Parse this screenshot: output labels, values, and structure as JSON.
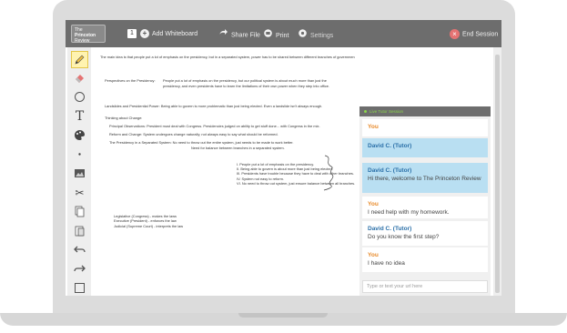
{
  "header": {
    "logo_line1": "The",
    "logo_line2": "Princeton",
    "logo_line3": "Review",
    "page_number": "1",
    "add_whiteboard": "Add Whiteboard",
    "share_file": "Share File",
    "print": "Print",
    "settings": "Settings",
    "end_session": "End Session"
  },
  "toolbar": {
    "tools": [
      "pencil-icon",
      "eraser-icon",
      "circle-shape-icon",
      "text-tool-icon",
      "color-palette-icon",
      "dot-size-icon",
      "image-icon",
      "scissors-icon",
      "copy-icon",
      "paste-icon",
      "undo-icon",
      "redo-icon",
      "rectangle-select-icon"
    ]
  },
  "canvas": {
    "line1": "The main idea is that people put a lot of emphasis on the presidency, but in a separated system, power has to be shared between different branches of governmen",
    "perspectives_label": "Perspectives on the Presidency:",
    "perspectives_text1": "People put a lot of emphasis on the presidency, but our political system is about much more than just the",
    "perspectives_text2": "presidency, and even presidents have to learn the limitations of their own power when they step into office.",
    "landslides": "Landslides and Presidential Power:  Being able to govern is more problematic than just being elected. Even a landslide isn't always enough.",
    "thinking": "Thinking about Change:",
    "principal": "Principal Observations: President must deal with Congress. Presidencies judged on ability to get stuff done... with Congress in the mix.",
    "reform": "Reform and Change:  System undergoes change naturally; not always easy to say what should be reformed.",
    "separated1": "The Presidency in a Separated System:  No need to throw out the entire system, just needs to be made to work better.",
    "separated2": "Need for balance between branches in a separated system.",
    "list": [
      "I. People put a lot of emphasis on the presidency.",
      "II. Being able to govern is about more than just being elected.",
      "III. Presidents have trouble because they have to deal with other branches.",
      "IV. System not easy to reform.",
      "VI. No need to throw out system, just ensure balance between all branches."
    ],
    "branches": [
      "Legislative (Congress) - makes the laws",
      "Executive (President) - enforces the law",
      "Judicial (Supreme Court) - interprets the law"
    ]
  },
  "chat": {
    "title": "Live Tutor Session",
    "messages": [
      {
        "sender": "You",
        "text": "",
        "role": "you"
      },
      {
        "sender": "David C. (Tutor)",
        "text": "",
        "role": "tutor"
      },
      {
        "sender": "David C. (Tutor)",
        "text": "Hi there, welcome to The Princeton Review",
        "role": "tutor"
      },
      {
        "sender": "You",
        "text": "I need help with my homework.",
        "role": "you"
      },
      {
        "sender": "David C. (Tutor)",
        "text": "Do you know the first step?",
        "role": "tutor-plain"
      },
      {
        "sender": "You",
        "text": "I have no idea",
        "role": "you"
      }
    ],
    "input_placeholder": "Type or text your url here"
  },
  "colors": {
    "topbar": "#6d6d6d",
    "chat_header": "#6d6d6d",
    "live_green": "#8bd64a",
    "tutor_highlight": "#b9dff2",
    "you_orange": "#e88a2a",
    "tutor_blue": "#2a6fa8",
    "end_red": "#e57373"
  }
}
